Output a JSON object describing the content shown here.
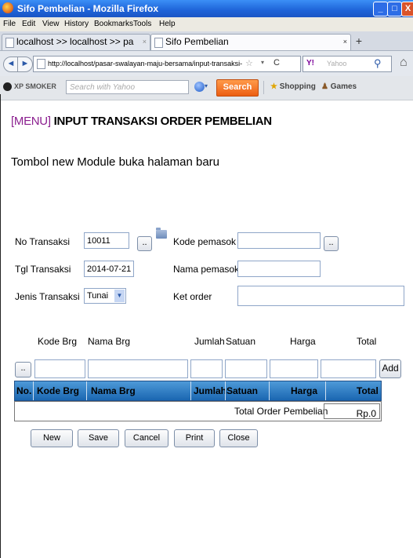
{
  "window": {
    "title": "Sifo Pembelian - Mozilla Firefox",
    "min": "_",
    "max": "□",
    "close": "X"
  },
  "menu": [
    "File",
    "Edit",
    "View",
    "History",
    "Bookmarks",
    "Tools",
    "Help"
  ],
  "tabs": [
    {
      "label": "localhost >> localhost >> pasar-swalaya...",
      "close": "×"
    },
    {
      "label": "Sifo Pembelian",
      "close": "×"
    }
  ],
  "newtab": "+",
  "nav": {
    "back": "◄",
    "forward": "►",
    "url": "http://localhost/pasar-swalayan-maju-bersama/input-transaksi-order-pemb",
    "star": "☆",
    "dropdown": "▾",
    "reload": "C",
    "search_brand": "Y!",
    "search_placeholder": "Yahoo",
    "search_icon": "⚲",
    "home_icon": "⌂"
  },
  "toolbar": {
    "brand": "XP SMOKER",
    "search_placeholder": "Search with Yahoo",
    "search_btn": "Search",
    "shopping": "Shopping",
    "games": "Games"
  },
  "page": {
    "menu_link": "[MENU]",
    "title": "INPUT TRANSAKSI ORDER PEMBELIAN",
    "subhead": "Tombol new Module buka halaman baru"
  },
  "form": {
    "no_transaksi_label": "No Transaksi",
    "no_transaksi_value": "10011",
    "browse_btn": "..",
    "kode_pemasok_label": "Kode pemasok",
    "kode_pemasok_value": "",
    "tgl_transaksi_label": "Tgl Transaksi",
    "tgl_transaksi_value": "2014-07-21",
    "nama_pemasok_label": "Nama pemasok",
    "nama_pemasok_value": "",
    "jenis_transaksi_label": "Jenis Transaksi",
    "jenis_transaksi_value": "Tunai",
    "jenis_arrow": "▼",
    "ket_order_label": "Ket order",
    "ket_order_value": ""
  },
  "entry": {
    "headers": [
      "Kode Brg",
      "Nama Brg",
      "Jumlah",
      "Satuan",
      "Harga",
      "Total"
    ],
    "browse_btn": "..",
    "add_btn": "Add"
  },
  "table": {
    "headers": [
      "No.",
      "Kode Brg",
      "Nama Brg",
      "Jumlah",
      "Satuan",
      "Harga",
      "Total"
    ],
    "total_label": "Total Order Pembelian",
    "total_value": "Rp.0"
  },
  "actions": [
    "New",
    "Save",
    "Cancel",
    "Print",
    "Close"
  ]
}
